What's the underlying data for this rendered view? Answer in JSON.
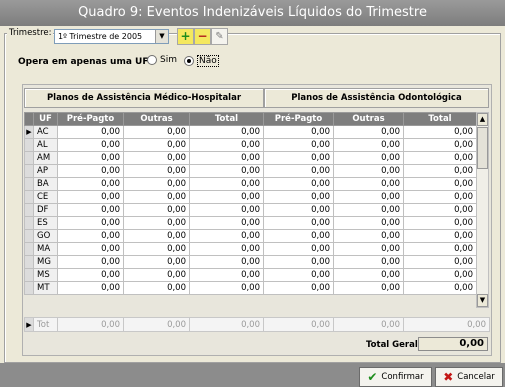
{
  "window": {
    "title": "Quadro 9: Eventos Indenizáveis Líquidos do Trimestre"
  },
  "toolbar": {
    "trimestre_label": "Trimestre:",
    "trimestre_value": "1º Trimestre de 2005",
    "add_icon": "plus-icon",
    "remove_icon": "minus-icon",
    "edit_icon": "pencil-icon"
  },
  "question": {
    "label": "Opera em apenas uma UF ?",
    "option_yes": "Sim",
    "option_no": "Não",
    "selected": "Não"
  },
  "groups": {
    "medico": "Planos de Assistência Médico-Hospitalar",
    "odonto": "Planos de Assistência Odontológica"
  },
  "columns": [
    "UF",
    "Pré-Pagto",
    "Outras",
    "Total",
    "Pré-Pagto",
    "Outras",
    "Total"
  ],
  "rows": [
    [
      "AC",
      "0,00",
      "0,00",
      "0,00",
      "0,00",
      "0,00",
      "0,00"
    ],
    [
      "AL",
      "0,00",
      "0,00",
      "0,00",
      "0,00",
      "0,00",
      "0,00"
    ],
    [
      "AM",
      "0,00",
      "0,00",
      "0,00",
      "0,00",
      "0,00",
      "0,00"
    ],
    [
      "AP",
      "0,00",
      "0,00",
      "0,00",
      "0,00",
      "0,00",
      "0,00"
    ],
    [
      "BA",
      "0,00",
      "0,00",
      "0,00",
      "0,00",
      "0,00",
      "0,00"
    ],
    [
      "CE",
      "0,00",
      "0,00",
      "0,00",
      "0,00",
      "0,00",
      "0,00"
    ],
    [
      "DF",
      "0,00",
      "0,00",
      "0,00",
      "0,00",
      "0,00",
      "0,00"
    ],
    [
      "ES",
      "0,00",
      "0,00",
      "0,00",
      "0,00",
      "0,00",
      "0,00"
    ],
    [
      "GO",
      "0,00",
      "0,00",
      "0,00",
      "0,00",
      "0,00",
      "0,00"
    ],
    [
      "MA",
      "0,00",
      "0,00",
      "0,00",
      "0,00",
      "0,00",
      "0,00"
    ],
    [
      "MG",
      "0,00",
      "0,00",
      "0,00",
      "0,00",
      "0,00",
      "0,00"
    ],
    [
      "MS",
      "0,00",
      "0,00",
      "0,00",
      "0,00",
      "0,00",
      "0,00"
    ],
    [
      "MT",
      "0,00",
      "0,00",
      "0,00",
      "0,00",
      "0,00",
      "0,00"
    ]
  ],
  "totals_row": [
    "Tot",
    "0,00",
    "0,00",
    "0,00",
    "0,00",
    "0,00",
    "0,00"
  ],
  "total_geral": {
    "label": "Total Geral:",
    "value": "0,00"
  },
  "buttons": {
    "confirm": "Confirmar",
    "cancel": "Cancelar"
  },
  "colors": {
    "accent_green": "#1c8c1c",
    "accent_red": "#c31616",
    "header_gray": "#7e7e7e"
  }
}
